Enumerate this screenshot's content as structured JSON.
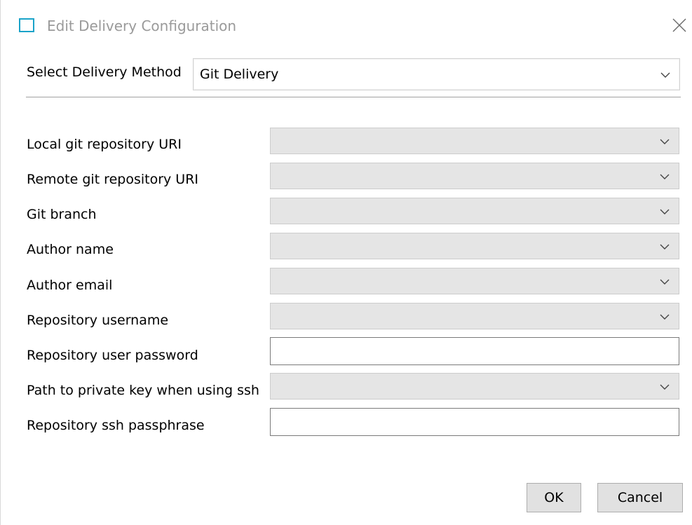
{
  "window": {
    "title": "Edit Delivery Configuration",
    "accent_color": "#1aa3c9"
  },
  "delivery_method": {
    "label": "Select Delivery Method",
    "value": "Git Delivery"
  },
  "fields": [
    {
      "label": "Local git repository URI",
      "type": "combo",
      "value": ""
    },
    {
      "label": "Remote git repository URI",
      "type": "combo",
      "value": ""
    },
    {
      "label": "Git branch",
      "type": "combo",
      "value": ""
    },
    {
      "label": "Author name",
      "type": "combo",
      "value": ""
    },
    {
      "label": "Author email",
      "type": "combo",
      "value": ""
    },
    {
      "label": "Repository username",
      "type": "combo",
      "value": ""
    },
    {
      "label": "Repository user password",
      "type": "text",
      "value": ""
    },
    {
      "label": "Path to private key when using ssh",
      "type": "combo",
      "value": ""
    },
    {
      "label": "Repository ssh passphrase",
      "type": "text",
      "value": ""
    }
  ],
  "buttons": {
    "ok": "OK",
    "cancel": "Cancel"
  },
  "icons": {
    "app": "window-icon",
    "close": "close-icon",
    "dropdown": "chevron-down-icon"
  }
}
